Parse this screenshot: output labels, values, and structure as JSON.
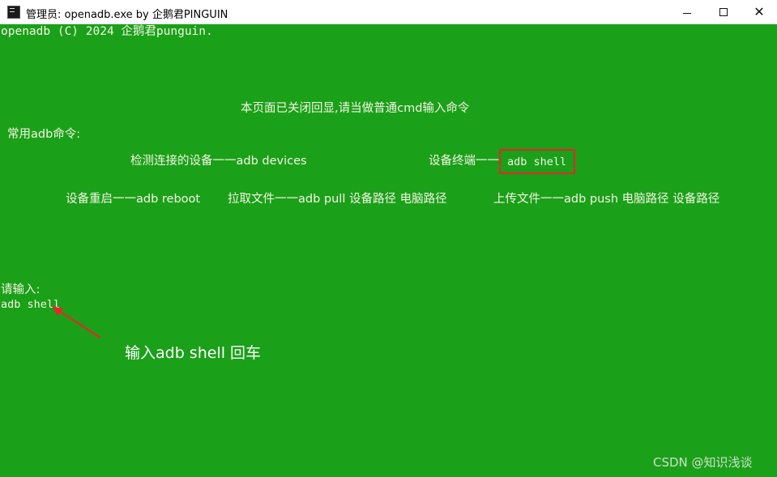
{
  "window": {
    "title": "管理员:  openadb.exe by 企鹅君PINGUIN",
    "icon": "console-app-icon",
    "controls": {
      "minimize": "minimize-icon",
      "maximize": "maximize-icon",
      "close": "close-icon"
    }
  },
  "console": {
    "background": "#1ba019",
    "text_color": "#f4f4e4",
    "copyright": "openadb (C) 2024 企鹅君punguin.",
    "notice": "本页面已关闭回显,请当做普通cmd输入命令",
    "common_commands_label": "常用adb命令:",
    "commands": {
      "detect_devices": "检测连接的设备一一adb devices",
      "device_terminal_label": "设备终端一一",
      "device_terminal_cmd": "adb shell",
      "reboot": "设备重启一一adb reboot",
      "pull": "拉取文件一一adb pull 设备路径 电脑路径",
      "push": "上传文件一一adb push 电脑路径 设备路径"
    },
    "prompt": "请输入:",
    "input_value": "adb shell"
  },
  "annotation": {
    "text": "输入adb shell 回车",
    "highlight_color": "#e8252b",
    "arrow_color": "#e8252b"
  },
  "watermark": "CSDN @知识浅谈"
}
